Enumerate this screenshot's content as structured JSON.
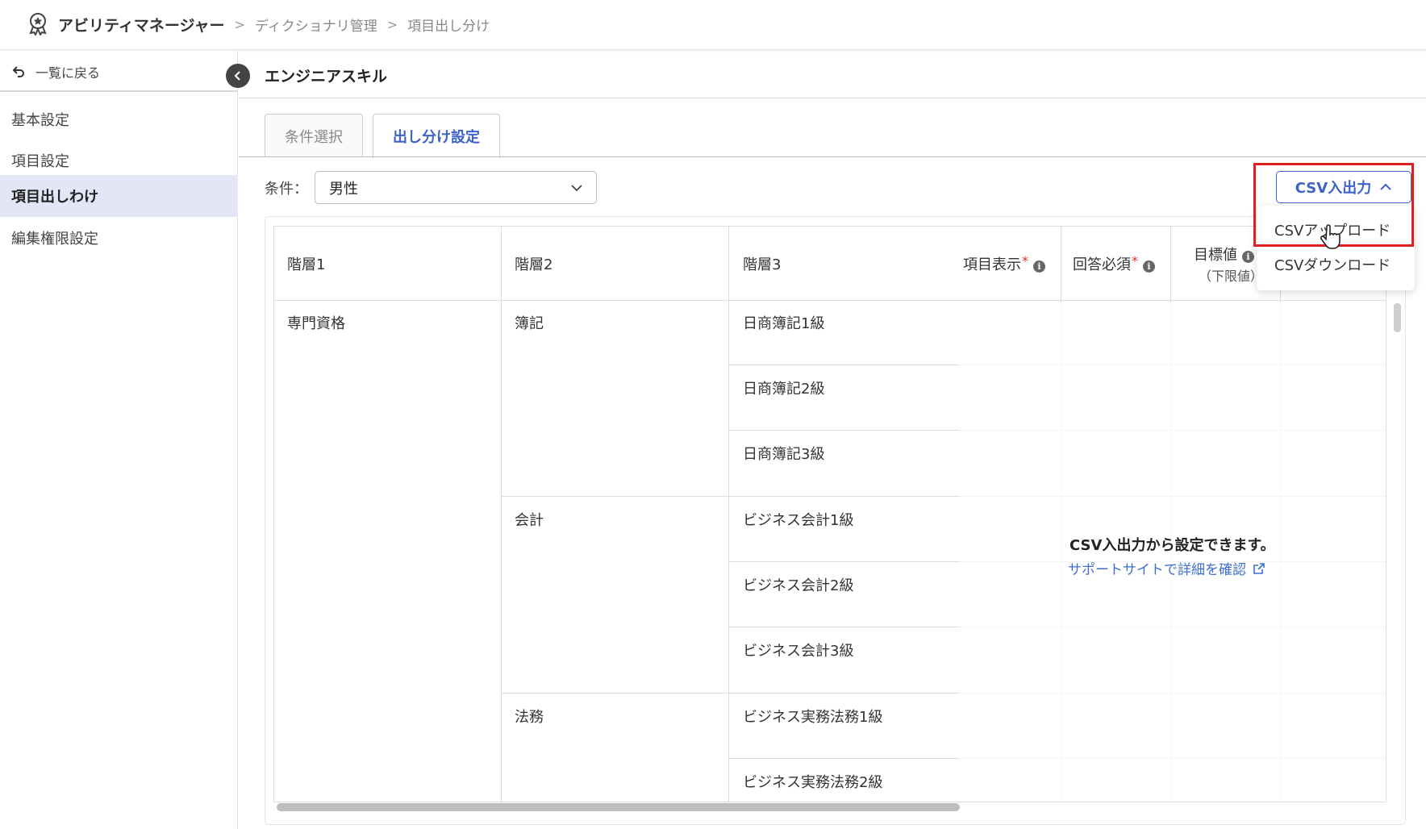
{
  "header": {
    "app_name": "アビリティマネージャー",
    "crumbs": [
      "ディクショナリ管理",
      "項目出し分け"
    ],
    "logo_icon": "award-badge-icon"
  },
  "sidebar": {
    "back_label": "一覧に戻る",
    "items": [
      {
        "label": "基本設定",
        "active": false
      },
      {
        "label": "項目設定",
        "active": false
      },
      {
        "label": "項目出しわけ",
        "active": true
      },
      {
        "label": "編集権限設定",
        "active": false
      }
    ]
  },
  "main": {
    "title": "エンジニアスキル",
    "tabs": [
      {
        "label": "条件選択",
        "active": false
      },
      {
        "label": "出し分け設定",
        "active": true
      }
    ],
    "condition": {
      "label": "条件：",
      "value": "男性"
    },
    "csv": {
      "button_label": "CSV入出力",
      "menu": [
        "CSVアップロード",
        "CSVダウンロード"
      ]
    },
    "table": {
      "headers": {
        "level1": "階層1",
        "level2": "階層2",
        "level3": "階層3",
        "display": "項目表示",
        "required": "回答必須",
        "target": "目標値",
        "target_sub": "（下限値）"
      },
      "level1": [
        "専門資格"
      ],
      "level2": [
        "簿記",
        "会計",
        "法務"
      ],
      "level3": [
        "日商簿記1級",
        "日商簿記2級",
        "日商簿記3級",
        "ビジネス会計1級",
        "ビジネス会計2級",
        "ビジネス会計3級",
        "ビジネス実務法務1級",
        "ビジネス実務法務2級"
      ]
    },
    "overlay": {
      "message": "CSV入出力から設定できます。",
      "link": "サポートサイトで詳細を確認"
    }
  },
  "colors": {
    "accent": "#3d63c9",
    "highlight": "#e02020",
    "active_nav": "#e3e6f6"
  }
}
